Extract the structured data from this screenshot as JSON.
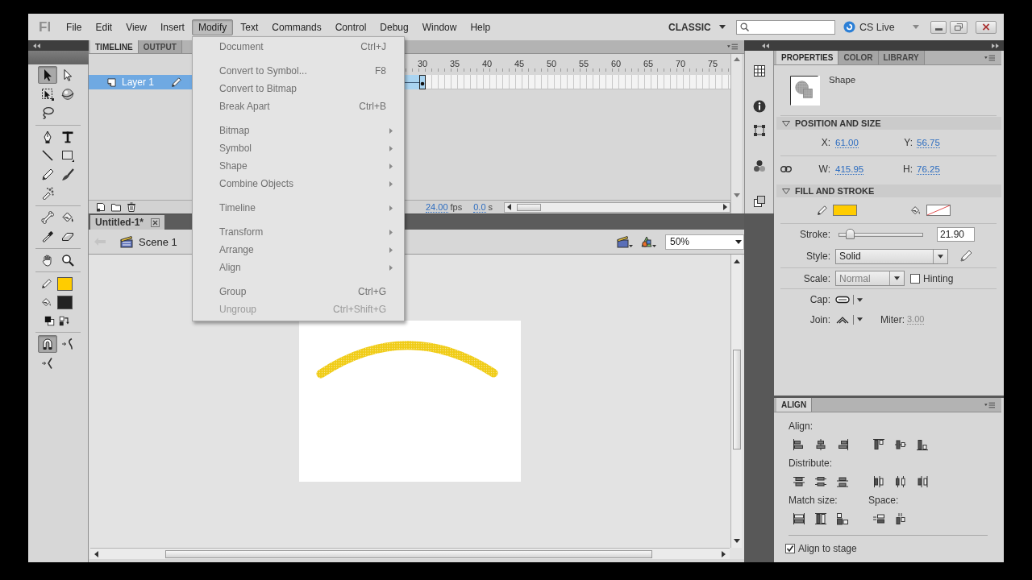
{
  "app": {
    "logo": "Fl"
  },
  "menu_bar": [
    {
      "label": "File",
      "selected": false
    },
    {
      "label": "Edit",
      "selected": false
    },
    {
      "label": "View",
      "selected": false
    },
    {
      "label": "Insert",
      "selected": false
    },
    {
      "label": "Modify",
      "selected": true
    },
    {
      "label": "Text",
      "selected": false
    },
    {
      "label": "Commands",
      "selected": false
    },
    {
      "label": "Control",
      "selected": false
    },
    {
      "label": "Debug",
      "selected": false
    },
    {
      "label": "Window",
      "selected": false
    },
    {
      "label": "Help",
      "selected": false
    }
  ],
  "workspace": "CLASSIC",
  "cs_live": "CS Live",
  "modify_menu": {
    "groups": [
      [
        {
          "label": "Document",
          "shortcut": "Ctrl+J",
          "submenu": false,
          "disabled": false
        }
      ],
      [
        {
          "label": "Convert to Symbol...",
          "shortcut": "F8",
          "submenu": false,
          "disabled": false
        },
        {
          "label": "Convert to Bitmap",
          "submenu": false,
          "disabled": false
        },
        {
          "label": "Break Apart",
          "shortcut": "Ctrl+B",
          "submenu": false,
          "disabled": false
        }
      ],
      [
        {
          "label": "Bitmap",
          "submenu": true,
          "disabled": false
        },
        {
          "label": "Symbol",
          "submenu": true,
          "disabled": false
        },
        {
          "label": "Shape",
          "submenu": true,
          "disabled": false
        },
        {
          "label": "Combine Objects",
          "submenu": true,
          "disabled": false
        }
      ],
      [
        {
          "label": "Timeline",
          "submenu": true,
          "disabled": false
        }
      ],
      [
        {
          "label": "Transform",
          "submenu": true,
          "disabled": false
        },
        {
          "label": "Arrange",
          "submenu": true,
          "disabled": false
        },
        {
          "label": "Align",
          "submenu": true,
          "disabled": false
        }
      ],
      [
        {
          "label": "Group",
          "shortcut": "Ctrl+G",
          "submenu": false,
          "disabled": false
        },
        {
          "label": "Ungroup",
          "shortcut": "Ctrl+Shift+G",
          "submenu": false,
          "disabled": true
        }
      ]
    ]
  },
  "tools": {
    "groups": [
      [
        {
          "kind": "arrow",
          "selected": true
        },
        {
          "kind": "subselect",
          "selected": false
        },
        {
          "kind": "transform",
          "selected": false
        },
        {
          "kind": "sphere",
          "selected": false
        },
        {
          "kind": "lasso",
          "selected": false
        }
      ],
      [
        {
          "kind": "pen",
          "selected": false
        },
        {
          "kind": "text",
          "selected": false
        },
        {
          "kind": "line",
          "selected": false
        },
        {
          "kind": "rectangle",
          "selected": false
        },
        {
          "kind": "pencil",
          "selected": false
        },
        {
          "kind": "brush",
          "selected": false
        },
        {
          "kind": "spray",
          "selected": false
        }
      ],
      [
        {
          "kind": "bone",
          "selected": false
        },
        {
          "kind": "bucket",
          "selected": false
        },
        {
          "kind": "eyedropper",
          "selected": false
        },
        {
          "kind": "eraser",
          "selected": false
        }
      ],
      [
        {
          "kind": "hand",
          "selected": false
        },
        {
          "kind": "zoom",
          "selected": false
        }
      ]
    ],
    "colors": [
      {
        "kind": "stroke",
        "color": "#ffcc00"
      },
      {
        "kind": "fill",
        "color": "#222222"
      }
    ],
    "options": [
      {
        "kind": "magnet",
        "on": true
      },
      {
        "kind": "smooth",
        "on": false
      },
      {
        "kind": "straighten",
        "on": false
      }
    ]
  },
  "timeline": {
    "tabs": [
      {
        "label": "TIMELINE",
        "selected": true
      },
      {
        "label": "OUTPUT",
        "selected": false
      }
    ],
    "frame_numbers": [
      "30",
      "35",
      "40",
      "45",
      "50",
      "55",
      "60",
      "65",
      "70",
      "75"
    ],
    "layers": [
      {
        "name": "Layer 1",
        "selected": true
      }
    ],
    "fps": "24.00",
    "fps_unit": "fps",
    "elapsed": "0.0",
    "elapsed_unit": "s"
  },
  "document": {
    "tabs": [
      {
        "label": "Untitled-1*",
        "selected": true
      }
    ],
    "scene": "Scene 1",
    "zoom": "50%"
  },
  "properties": {
    "tabs": [
      {
        "label": "PROPERTIES",
        "selected": true
      },
      {
        "label": "COLOR",
        "selected": false
      },
      {
        "label": "LIBRARY",
        "selected": false
      }
    ],
    "object_type": "Shape",
    "position_and_size": {
      "title": "POSITION AND SIZE",
      "expanded": true,
      "fields": [
        {
          "label": "X:",
          "value": "61.00"
        },
        {
          "label": "Y:",
          "value": "56.75"
        },
        {
          "label": "W:",
          "value": "415.95"
        },
        {
          "label": "H:",
          "value": "76.25"
        }
      ]
    },
    "fill_and_stroke": {
      "title": "FILL AND STROKE",
      "expanded": true,
      "swatches": [
        {
          "kind": "stroke",
          "color": "#ffcc00",
          "empty": false
        },
        {
          "kind": "fill",
          "empty": true
        }
      ],
      "stroke": {
        "label": "Stroke:",
        "level": 0.1,
        "value": "21.90"
      },
      "style": {
        "label": "Style:",
        "value": "Solid"
      },
      "scale": {
        "label": "Scale:",
        "value": "Normal",
        "disabled": true
      },
      "hinting": {
        "label": "Hinting",
        "checked": false
      },
      "cap": {
        "label": "Cap:"
      },
      "join": {
        "label": "Join:"
      },
      "miter": {
        "label": "Miter:",
        "value": "3.00",
        "disabled": true
      }
    }
  },
  "align_panel": {
    "tabs": [
      {
        "label": "ALIGN",
        "selected": true
      }
    ],
    "align_label": "Align:",
    "distribute_label": "Distribute:",
    "match_size_label": "Match size:",
    "space_label": "Space:",
    "to_stage": {
      "label": "Align to stage",
      "checked": true
    }
  }
}
